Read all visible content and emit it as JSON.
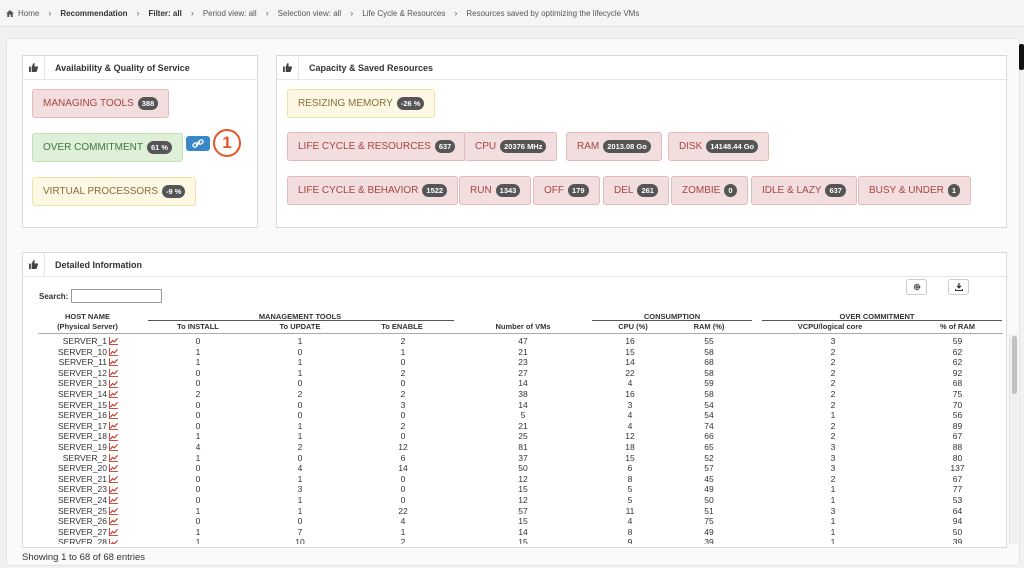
{
  "breadcrumb": {
    "home": "Home",
    "items": [
      "Recommendation",
      "Filter: all",
      "Period view: all",
      "Selection view: all",
      "Life Cycle & Resources",
      "Resources saved by optimizing the lifecycle VMs"
    ]
  },
  "availability": {
    "title": "Availability & Quality of Service",
    "managing_tools": {
      "label": "MANAGING TOOLS",
      "badge": "388"
    },
    "over_commitment": {
      "label": "OVER COMMITMENT",
      "badge": "61 %"
    },
    "virtual_processors": {
      "label": "VIRTUAL PROCESSORS",
      "badge": "-9 %"
    },
    "marker": "1"
  },
  "capacity": {
    "title": "Capacity & Saved Resources",
    "resizing_memory": {
      "label": "RESIZING MEMORY",
      "badge": "-26 %"
    },
    "lifecycle_resources": {
      "label": "LIFE CYCLE & RESOURCES",
      "badge": "637"
    },
    "cpu": {
      "label": "CPU",
      "badge": "20376 MHz"
    },
    "ram": {
      "label": "RAM",
      "badge": "2013.08 Go"
    },
    "disk": {
      "label": "DISK",
      "badge": "14148.44 Go"
    },
    "lifecycle_behavior": {
      "label": "LIFE CYCLE & BEHAVIOR",
      "badge": "1522"
    },
    "run": {
      "label": "RUN",
      "badge": "1343"
    },
    "off": {
      "label": "OFF",
      "badge": "179"
    },
    "del": {
      "label": "DEL",
      "badge": "261"
    },
    "zombie": {
      "label": "ZOMBIE",
      "badge": "0"
    },
    "idle_lazy": {
      "label": "IDLE & LAZY",
      "badge": "637"
    },
    "busy_under": {
      "label": "BUSY & UNDER",
      "badge": "1"
    }
  },
  "detailed": {
    "title": "Detailed Information",
    "search_label": "Search:",
    "headers": {
      "host_name": "HOST NAME",
      "host_sub": "(Physical Server)",
      "management_tools": "MANAGEMENT TOOLS",
      "to_install": "To INSTALL",
      "to_update": "To UPDATE",
      "to_enable": "To ENABLE",
      "num_vms": "Number of VMs",
      "consumption": "CONSUMPTION",
      "cpu_pct": "CPU (%)",
      "ram_pct": "RAM (%)",
      "over_commitment": "OVER COMMITMENT",
      "vcpu": "VCPU/logical core",
      "pct_ram": "% of RAM"
    },
    "rows": [
      [
        "SERVER_1",
        "0",
        "1",
        "2",
        "47",
        "16",
        "55",
        "3",
        "59"
      ],
      [
        "SERVER_10",
        "1",
        "0",
        "1",
        "21",
        "15",
        "58",
        "2",
        "62"
      ],
      [
        "SERVER_11",
        "1",
        "1",
        "0",
        "23",
        "14",
        "68",
        "2",
        "62"
      ],
      [
        "SERVER_12",
        "0",
        "1",
        "2",
        "27",
        "22",
        "58",
        "2",
        "92"
      ],
      [
        "SERVER_13",
        "0",
        "0",
        "0",
        "14",
        "4",
        "59",
        "2",
        "68"
      ],
      [
        "SERVER_14",
        "2",
        "2",
        "2",
        "38",
        "16",
        "58",
        "2",
        "75"
      ],
      [
        "SERVER_15",
        "0",
        "0",
        "3",
        "14",
        "3",
        "54",
        "2",
        "70"
      ],
      [
        "SERVER_16",
        "0",
        "0",
        "0",
        "5",
        "4",
        "54",
        "1",
        "56"
      ],
      [
        "SERVER_17",
        "0",
        "1",
        "2",
        "21",
        "4",
        "74",
        "2",
        "89"
      ],
      [
        "SERVER_18",
        "1",
        "1",
        "0",
        "25",
        "12",
        "66",
        "2",
        "67"
      ],
      [
        "SERVER_19",
        "4",
        "2",
        "12",
        "81",
        "18",
        "65",
        "3",
        "88"
      ],
      [
        "SERVER_2",
        "1",
        "0",
        "6",
        "37",
        "15",
        "52",
        "3",
        "80"
      ],
      [
        "SERVER_20",
        "0",
        "4",
        "14",
        "50",
        "6",
        "57",
        "3",
        "137"
      ],
      [
        "SERVER_21",
        "0",
        "1",
        "0",
        "12",
        "8",
        "45",
        "2",
        "67"
      ],
      [
        "SERVER_23",
        "0",
        "3",
        "0",
        "15",
        "5",
        "49",
        "1",
        "77"
      ],
      [
        "SERVER_24",
        "0",
        "1",
        "0",
        "12",
        "5",
        "50",
        "1",
        "53"
      ],
      [
        "SERVER_25",
        "1",
        "1",
        "22",
        "57",
        "11",
        "51",
        "3",
        "64"
      ],
      [
        "SERVER_26",
        "0",
        "0",
        "4",
        "15",
        "4",
        "75",
        "1",
        "94"
      ],
      [
        "SERVER_27",
        "1",
        "7",
        "1",
        "14",
        "8",
        "49",
        "1",
        "50"
      ],
      [
        "SERVER_28",
        "1",
        "10",
        "2",
        "15",
        "9",
        "39",
        "1",
        "39"
      ]
    ],
    "footer": "Showing 1 to 68 of 68 entries"
  },
  "colors": {
    "accent_blue": "#3a87c8",
    "marker_orange": "#e8532a",
    "danger_bg": "#f2dede",
    "success_bg": "#dff0d8",
    "warning_bg": "#fcf8e3"
  }
}
